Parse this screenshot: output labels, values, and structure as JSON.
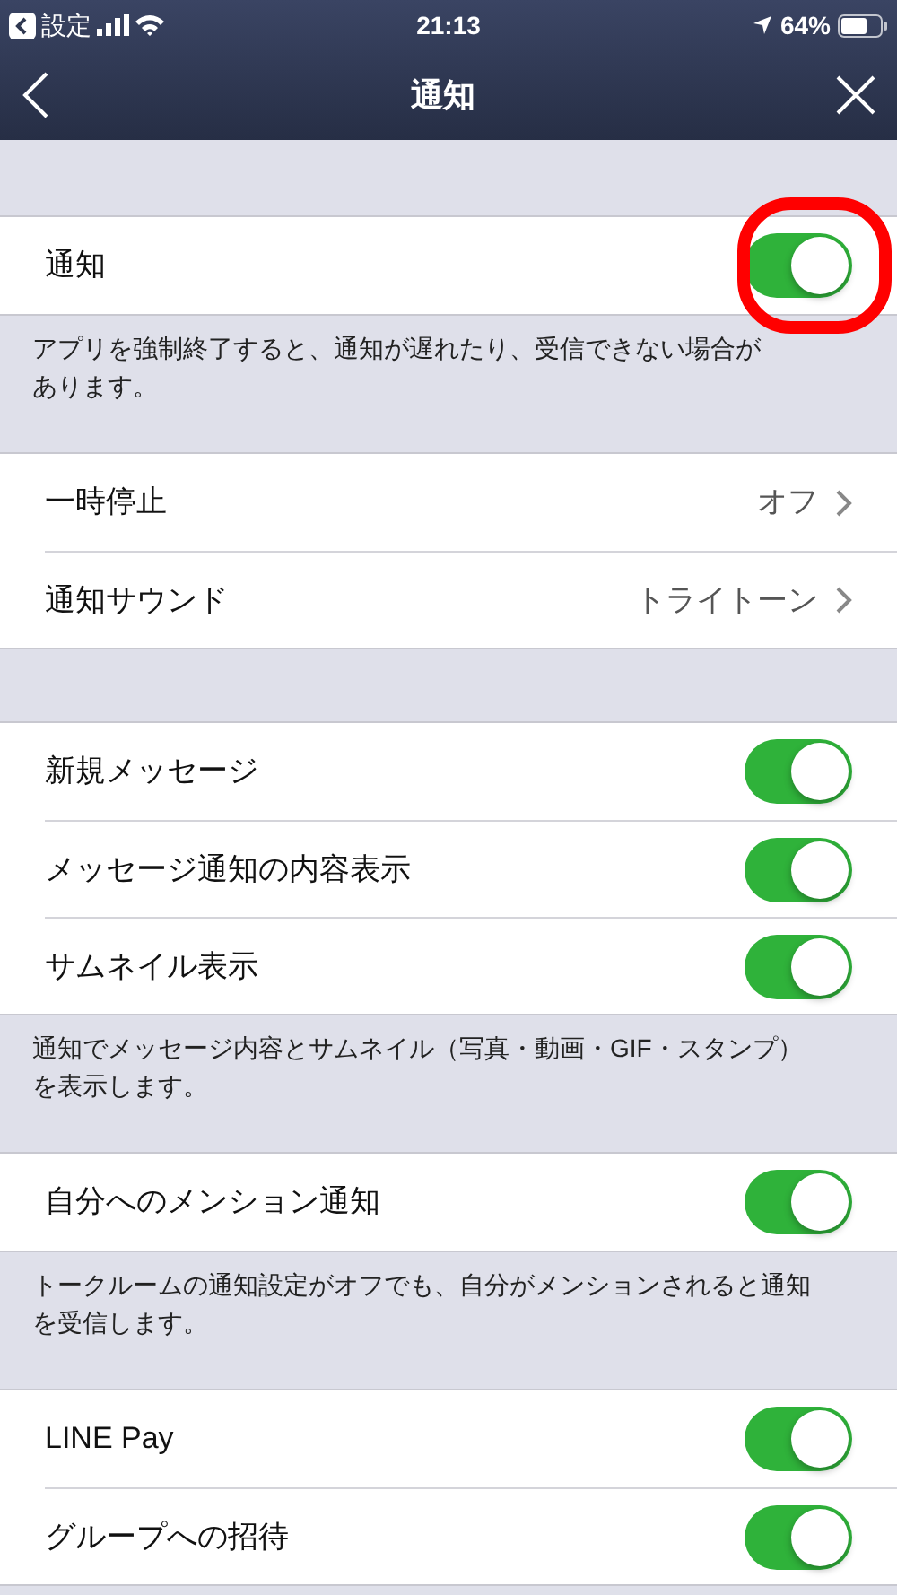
{
  "status_bar": {
    "back_app": "設定",
    "time": "21:13",
    "battery": "64%"
  },
  "nav": {
    "title": "通知"
  },
  "sections": [
    {
      "rows": [
        {
          "kind": "toggle",
          "label": "通知",
          "on": true,
          "highlighted": true
        }
      ],
      "note": [
        "アプリを強制終了すると、通知が遅れたり、受信できない場合が",
        "あります。"
      ]
    },
    {
      "rows": [
        {
          "kind": "value",
          "label": "一時停止",
          "value": "オフ"
        },
        {
          "kind": "value",
          "label": "通知サウンド",
          "value": "トライトーン"
        }
      ]
    },
    {
      "rows": [
        {
          "kind": "toggle",
          "label": "新規メッセージ",
          "on": true,
          "highlighted": false
        },
        {
          "kind": "toggle",
          "label": "メッセージ通知の内容表示",
          "on": true,
          "highlighted": false
        },
        {
          "kind": "toggle",
          "label": "サムネイル表示",
          "on": true,
          "highlighted": false
        }
      ],
      "note": [
        "通知でメッセージ内容とサムネイル（写真・動画・GIF・スタンプ）",
        "を表示します。"
      ]
    },
    {
      "rows": [
        {
          "kind": "toggle",
          "label": "自分へのメンション通知",
          "on": true,
          "highlighted": false
        }
      ],
      "note": [
        "トークルームの通知設定がオフでも、自分がメンションされると通知",
        "を受信します。"
      ]
    },
    {
      "rows": [
        {
          "kind": "toggle",
          "label": "LINE Pay",
          "on": true,
          "highlighted": false
        },
        {
          "kind": "toggle",
          "label": "グループへの招待",
          "on": true,
          "highlighted": false
        }
      ]
    }
  ]
}
